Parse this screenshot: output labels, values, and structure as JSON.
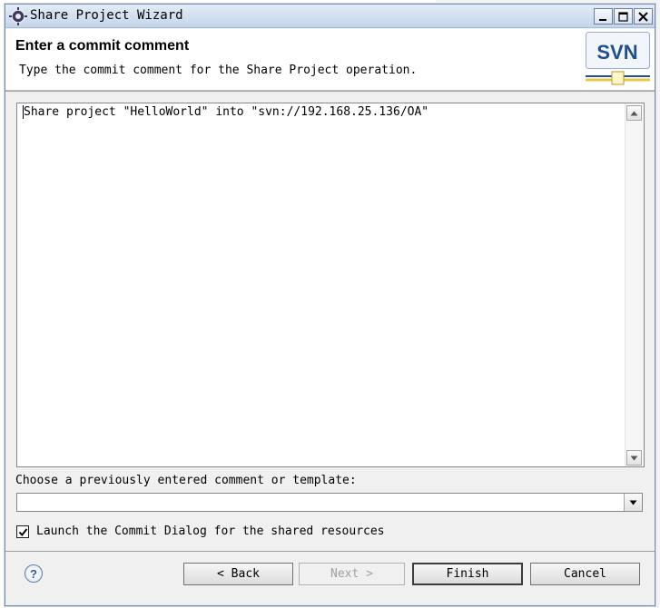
{
  "window": {
    "title": "Share Project Wizard",
    "minimize_icon": "minimize-icon",
    "maximize_icon": "maximize-icon",
    "close_icon": "close-icon"
  },
  "header": {
    "title": "Enter a commit comment",
    "description": "Type the commit comment for the Share Project operation.",
    "logo_text": "SVN"
  },
  "comment": {
    "value": "Share project \"HelloWorld\" into \"svn://192.168.25.136/OA\""
  },
  "template": {
    "label": "Choose a previously entered comment or template:",
    "selected": ""
  },
  "launch_commit": {
    "label": "Launch the Commit Dialog for the shared resources",
    "checked": true
  },
  "buttons": {
    "back": "< Back",
    "next": "Next >",
    "finish": "Finish",
    "cancel": "Cancel",
    "help": "?"
  },
  "colors": {
    "titlebar": "#c4d5ea",
    "svn_blue": "#1f4f8c",
    "svn_gold": "#e8c84a"
  }
}
